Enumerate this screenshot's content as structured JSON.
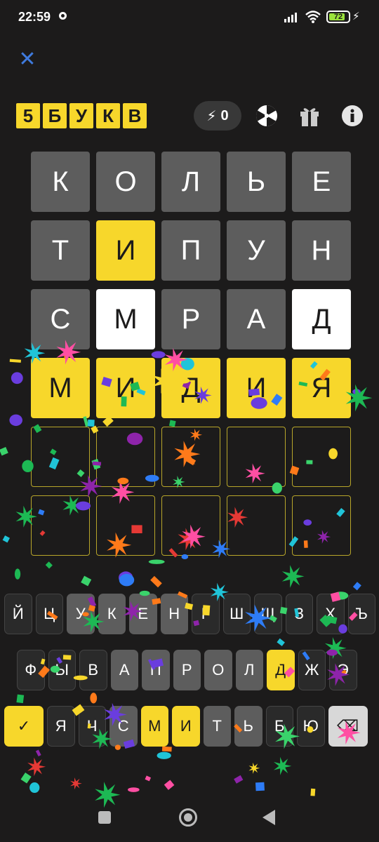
{
  "status": {
    "time": "22:59",
    "battery": "72"
  },
  "logo": [
    "5",
    "Б",
    "У",
    "К",
    "В"
  ],
  "hints": {
    "count": "0"
  },
  "board": [
    [
      {
        "l": "К",
        "s": "gray"
      },
      {
        "l": "О",
        "s": "gray"
      },
      {
        "l": "Л",
        "s": "gray"
      },
      {
        "l": "Ь",
        "s": "gray"
      },
      {
        "l": "Е",
        "s": "gray"
      }
    ],
    [
      {
        "l": "Т",
        "s": "gray"
      },
      {
        "l": "И",
        "s": "yellow"
      },
      {
        "l": "П",
        "s": "gray"
      },
      {
        "l": "У",
        "s": "gray"
      },
      {
        "l": "Н",
        "s": "gray"
      }
    ],
    [
      {
        "l": "С",
        "s": "gray"
      },
      {
        "l": "М",
        "s": "white"
      },
      {
        "l": "Р",
        "s": "gray"
      },
      {
        "l": "А",
        "s": "gray"
      },
      {
        "l": "Д",
        "s": "white"
      }
    ],
    [
      {
        "l": "М",
        "s": "yellow"
      },
      {
        "l": "И",
        "s": "yellow"
      },
      {
        "l": "Д",
        "s": "yellow"
      },
      {
        "l": "И",
        "s": "yellow"
      },
      {
        "l": "Я",
        "s": "yellow"
      }
    ],
    [
      {
        "l": "",
        "s": "empty"
      },
      {
        "l": "",
        "s": "empty"
      },
      {
        "l": "",
        "s": "empty"
      },
      {
        "l": "",
        "s": "empty"
      },
      {
        "l": "",
        "s": "empty"
      }
    ],
    [
      {
        "l": "",
        "s": "empty"
      },
      {
        "l": "",
        "s": "empty"
      },
      {
        "l": "",
        "s": "empty"
      },
      {
        "l": "",
        "s": "empty"
      },
      {
        "l": "",
        "s": "empty"
      }
    ]
  ],
  "keyboard": {
    "row1": [
      {
        "l": "Й",
        "s": "dark"
      },
      {
        "l": "Ц",
        "s": "dark"
      },
      {
        "l": "У",
        "s": "gray"
      },
      {
        "l": "К",
        "s": "gray"
      },
      {
        "l": "Е",
        "s": "gray"
      },
      {
        "l": "Н",
        "s": "gray"
      },
      {
        "l": "Г",
        "s": "dark"
      },
      {
        "l": "Ш",
        "s": "dark"
      },
      {
        "l": "Щ",
        "s": "dark"
      },
      {
        "l": "З",
        "s": "dark"
      },
      {
        "l": "Х",
        "s": "dark"
      },
      {
        "l": "Ъ",
        "s": "dark"
      }
    ],
    "row2": [
      {
        "l": "Ф",
        "s": "dark"
      },
      {
        "l": "Ы",
        "s": "dark"
      },
      {
        "l": "В",
        "s": "dark"
      },
      {
        "l": "А",
        "s": "gray"
      },
      {
        "l": "П",
        "s": "gray"
      },
      {
        "l": "Р",
        "s": "gray"
      },
      {
        "l": "О",
        "s": "gray"
      },
      {
        "l": "Л",
        "s": "gray"
      },
      {
        "l": "Д",
        "s": "yellow"
      },
      {
        "l": "Ж",
        "s": "dark"
      },
      {
        "l": "Э",
        "s": "dark"
      }
    ],
    "row3": [
      {
        "l": "✓",
        "s": "yellow",
        "icon": "check-icon",
        "wide": true
      },
      {
        "l": "Я",
        "s": "dark"
      },
      {
        "l": "Ч",
        "s": "dark"
      },
      {
        "l": "С",
        "s": "gray"
      },
      {
        "l": "М",
        "s": "yellow"
      },
      {
        "l": "И",
        "s": "yellow"
      },
      {
        "l": "Т",
        "s": "gray"
      },
      {
        "l": "Ь",
        "s": "gray"
      },
      {
        "l": "Б",
        "s": "dark"
      },
      {
        "l": "Ю",
        "s": "dark"
      },
      {
        "l": "⌫",
        "s": "light",
        "icon": "backspace-icon",
        "wide": true
      }
    ]
  },
  "colors": {
    "yellow": "#f7d72b",
    "gray": "#5d5d5d",
    "bg": "#1c1b1b",
    "accent": "#3f7bde"
  }
}
